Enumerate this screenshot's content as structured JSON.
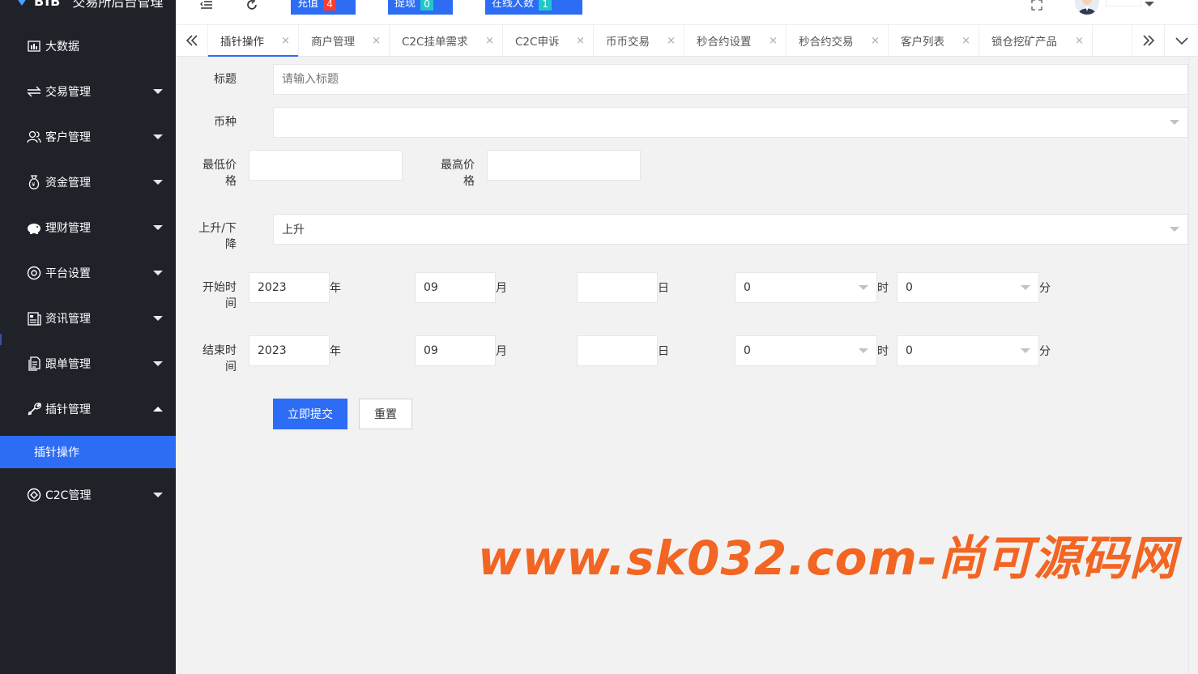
{
  "app": {
    "logo_text": "BIB",
    "title": "交易所后台管理"
  },
  "sidebar": {
    "items": [
      {
        "label": "大数据",
        "icon": "chart-icon"
      },
      {
        "label": "交易管理",
        "icon": "exchange-icon"
      },
      {
        "label": "客户管理",
        "icon": "users-icon"
      },
      {
        "label": "资金管理",
        "icon": "moneybag-icon"
      },
      {
        "label": "理财管理",
        "icon": "piggybank-icon"
      },
      {
        "label": "平台设置",
        "icon": "settings-icon"
      },
      {
        "label": "资讯管理",
        "icon": "news-icon"
      },
      {
        "label": "跟单管理",
        "icon": "document-icon"
      },
      {
        "label": "插针管理",
        "icon": "wrench-icon"
      },
      {
        "label": "C2C管理",
        "icon": "diamond-icon"
      }
    ],
    "active_sub": "插针操作"
  },
  "header": {
    "recharge_label": "充值",
    "recharge_count": "4",
    "withdraw_label": "提现",
    "withdraw_count": "0",
    "online_label": "在线人数",
    "online_count": "1"
  },
  "tabs": [
    {
      "label": "插针操作",
      "active": true
    },
    {
      "label": "商户管理"
    },
    {
      "label": "C2C挂单需求"
    },
    {
      "label": "C2C申诉"
    },
    {
      "label": "币币交易"
    },
    {
      "label": "秒合约设置"
    },
    {
      "label": "秒合约交易"
    },
    {
      "label": "客户列表"
    },
    {
      "label": "锁仓挖矿产品"
    }
  ],
  "tab_close_glyph": "×",
  "form": {
    "title_label": "标题",
    "title_placeholder": "请输入标题",
    "coin_label": "币种",
    "coin_value": "",
    "min_price_label_1": "最低价",
    "min_price_label_2": "格",
    "max_price_label_1": "最高价",
    "max_price_label_2": "格",
    "direction_label_1": "上升/下",
    "direction_label_2": "降",
    "direction_value": "上升",
    "start_label_1": "开始时",
    "start_label_2": "间",
    "end_label_1": "结束时",
    "end_label_2": "间",
    "start": {
      "year": "2023",
      "month": "09",
      "day": "",
      "hour": "0",
      "minute": "0"
    },
    "end": {
      "year": "2023",
      "month": "09",
      "day": "",
      "hour": "0",
      "minute": "0"
    },
    "unit_year": "年",
    "unit_month": "月",
    "unit_day": "日",
    "unit_hour": "时",
    "unit_minute": "分",
    "submit_label": "立即提交",
    "reset_label": "重置"
  },
  "watermark": "www.sk032.com-尚可源码网",
  "colors": {
    "sidebar_bg": "#20222a",
    "accent": "#2d6cf5",
    "badge_red": "#ff3b30",
    "badge_teal": "#1fc8c8",
    "watermark": "#f26522"
  }
}
